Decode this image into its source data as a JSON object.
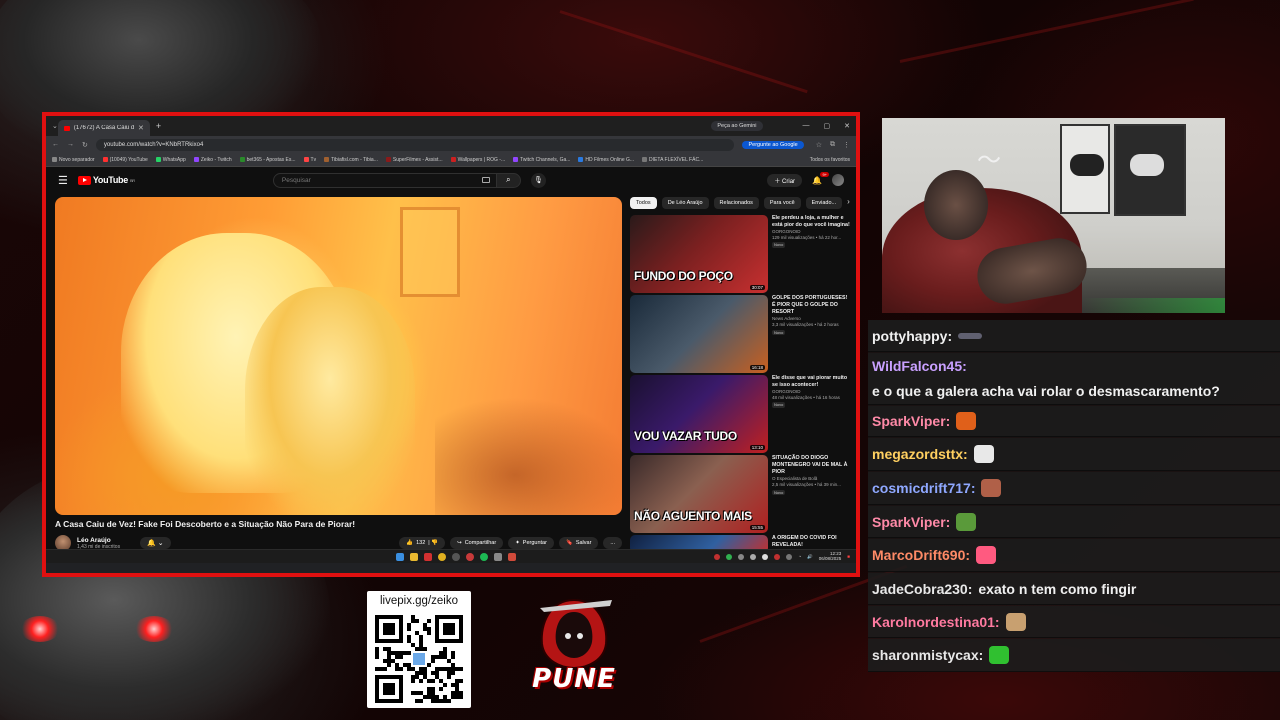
{
  "overlay": {
    "accent": "#e01010",
    "qr_url": "livepix.gg/zeiko",
    "logo_text": "PUNE"
  },
  "browser": {
    "tab_title": "(17672) A Casa Caiu de Vez!",
    "new_tab": "+",
    "gemini_label": "Peça ao Gemini",
    "url": "youtube.com/watch?v=KNbRTRkixo4",
    "google_button": "Pergunte ao Google",
    "bookmarks": [
      "Novo separador",
      "(10049) YouTube",
      "WhatsApp",
      "Zeiko - Twitch",
      "bet365 - Apostas Es...",
      "Tv",
      "Tibiafisl.com - Tibia...",
      "SuperFilmes - Assist...",
      "Wallpapers | ROG -...",
      "Twitch Channels, Ga...",
      "HD Filmes Online G...",
      "DIETA FLEXÍVEL FÁC..."
    ],
    "bookmarks_right": "Todos os favoritos"
  },
  "youtube": {
    "logo": "YouTube",
    "logo_region": "BR",
    "search_placeholder": "Pesquisar",
    "create_label": "Criar",
    "notif_count": "9+",
    "video_title": "A Casa Caiu de Vez! Fake Foi Descoberto e a Situação Não Para de Piorar!",
    "channel_name": "Léo Araújo",
    "channel_subs": "1,43 mi de inscritos",
    "likes": "132",
    "share_label": "Compartilhar",
    "ask_label": "Perguntar",
    "save_label": "Salvar",
    "more_label": "...",
    "chips": [
      "Todos",
      "De Léo Araújo",
      "Relacionados",
      "Para você",
      "Enviado..."
    ],
    "recommendations": [
      {
        "caption": "FUNDO DO POÇO",
        "duration": "30:07",
        "title": "Ele perdeu a loja, a mulher e está pior do que você imagina!",
        "channel": "GORGONOID",
        "meta": "129 mil visualizações • há 22 hor...",
        "badge": "Novo"
      },
      {
        "caption": "",
        "duration": "16:18",
        "title": "GOLPE DOS PORTUGUESES! É PIOR QUE O GOLPE DO RESORT",
        "channel": "News Adverso",
        "meta": "3,3 mil visualizações • há 2 horas",
        "badge": "Novo"
      },
      {
        "caption": "VOU VAZAR TUDO",
        "duration": "13:10",
        "title": "Ele disse que vai piorar muito se isso acontecer!",
        "channel": "GORGONOID",
        "meta": "48 mil visualizações • há 16 horas",
        "badge": "Novo"
      },
      {
        "caption": "NÃO AGUENTO MAIS",
        "duration": "15:55",
        "title": "SITUAÇÃO DO DIOGO MONTENEGRO VAI DE MAL À PIOR",
        "channel": "O Especialista de Bolã",
        "meta": "2,5 mil visualizações • há 39 min...",
        "badge": "Novo"
      },
      {
        "caption": "",
        "duration": "",
        "title": "A ORIGEM DO COVID FOI REVELADA!",
        "channel": "",
        "meta": "",
        "badge": ""
      }
    ]
  },
  "taskbar": {
    "time": "12:23",
    "date": "06/08/2025"
  },
  "chat": [
    {
      "user": "pottyhappy:",
      "color": "#f0f0f0",
      "message": "",
      "emote": "#606070"
    },
    {
      "user": "WildFalcon45:",
      "color": "#c9a0ff",
      "message": "e o que a galera acha vai rolar o desmascaramento?",
      "emote": ""
    },
    {
      "user": "SparkViper:",
      "color": "#ff8aa8",
      "message": "",
      "emote": "#e0601a"
    },
    {
      "user": "megazordsttx:",
      "color": "#ffd060",
      "message": "",
      "emote": "#e8e8e8"
    },
    {
      "user": "cosmicdrift717:",
      "color": "#8fa8ff",
      "message": "",
      "emote": "#b06048"
    },
    {
      "user": "SparkViper:",
      "color": "#ff8aa8",
      "message": "",
      "emote": "#5a9a3a"
    },
    {
      "user": "MarcoDrift690:",
      "color": "#ff8a66",
      "message": "",
      "emote": "#ff5a80"
    },
    {
      "user": "JadeCobra230:",
      "color": "#e8e8e8",
      "message": "exato n tem como fingir",
      "emote": ""
    },
    {
      "user": "Karolnordestina01:",
      "color": "#ff7aa0",
      "message": "",
      "emote": "#c8a070"
    },
    {
      "user": "sharonmistycax:",
      "color": "#e8e8e8",
      "message": "",
      "emote": "#30c030"
    }
  ]
}
